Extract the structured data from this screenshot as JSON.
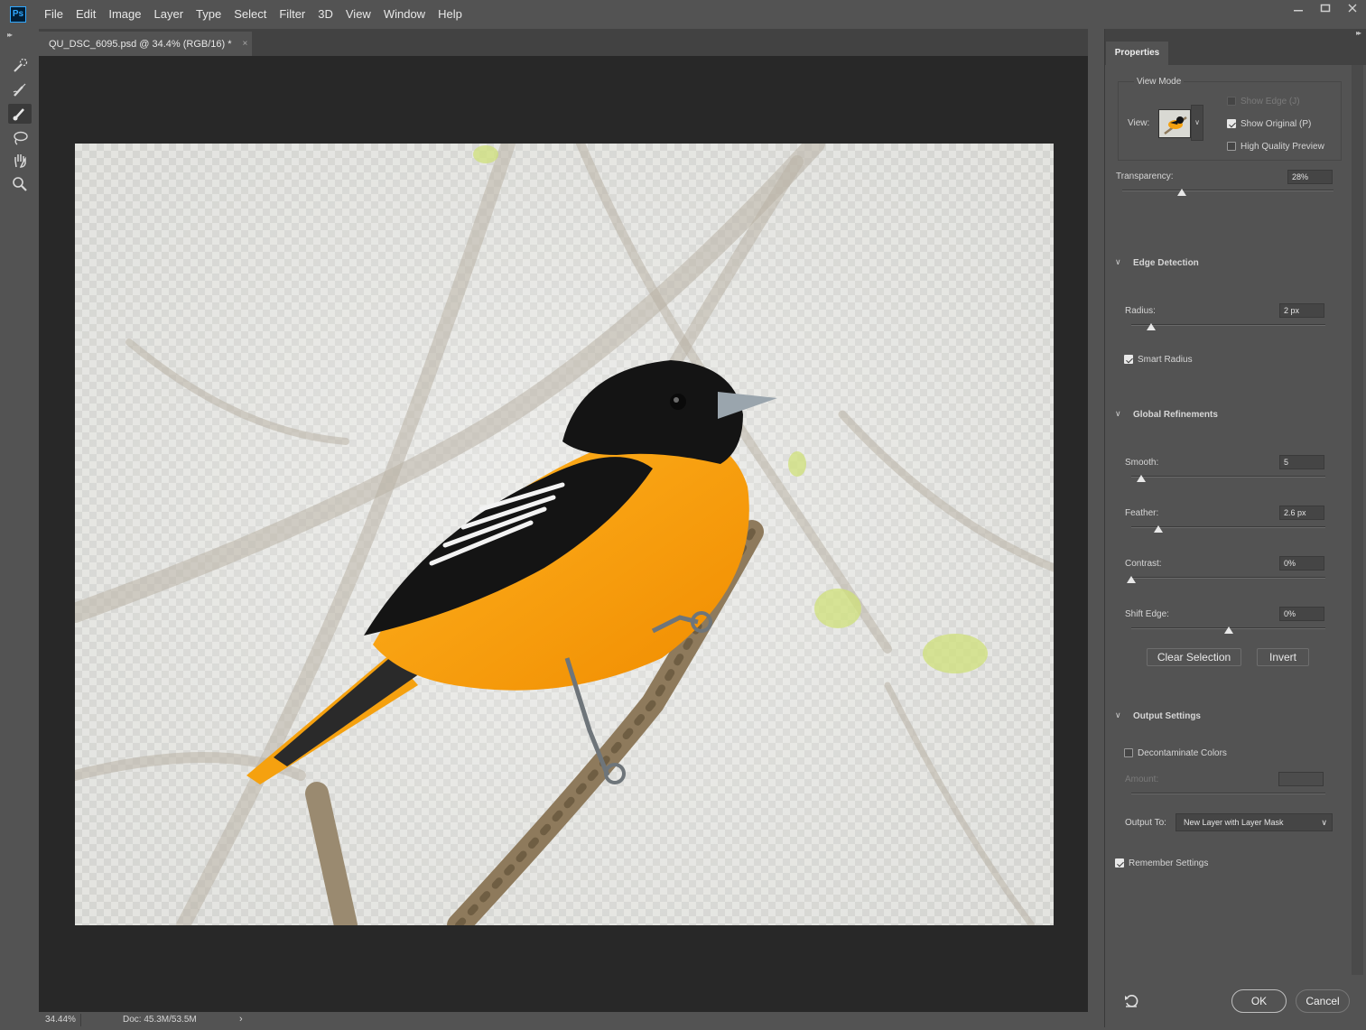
{
  "app": {
    "logo": "Ps",
    "menu": [
      "File",
      "Edit",
      "Image",
      "Layer",
      "Type",
      "Select",
      "Filter",
      "3D",
      "View",
      "Window",
      "Help"
    ],
    "window_controls": [
      "minimize-icon",
      "restore-icon",
      "close-icon"
    ]
  },
  "tools": [
    "quick-selection-icon",
    "refine-edge-brush-icon",
    "brush-icon",
    "lasso-icon",
    "hand-icon",
    "zoom-icon"
  ],
  "active_tool": "brush-icon",
  "document": {
    "tab_title": "QU_DSC_6095.psd @ 34.4% (RGB/16) *",
    "close_symbol": "×"
  },
  "statusbar": {
    "zoom": "34.44%",
    "doc_size": "Doc: 45.3M/53.5M",
    "arrow": "›"
  },
  "panel": {
    "tab": "Properties",
    "view_mode": {
      "title": "View Mode",
      "view_label": "View:",
      "show_edge": "Show Edge (J)",
      "show_original": "Show Original (P)",
      "high_quality": "High Quality Preview",
      "show_edge_checked": false,
      "show_original_checked": true,
      "high_quality_checked": false
    },
    "transparency": {
      "label": "Transparency:",
      "value": "28%",
      "level": 0.28
    },
    "edge_detection": {
      "title": "Edge Detection",
      "radius_label": "Radius:",
      "radius_value": "2 px",
      "radius_level": 0.1,
      "smart_radius": "Smart Radius",
      "smart_radius_checked": true
    },
    "global_refinements": {
      "title": "Global Refinements",
      "smooth_label": "Smooth:",
      "smooth_value": "5",
      "smooth_level": 0.05,
      "feather_label": "Feather:",
      "feather_value": "2.6 px",
      "feather_level": 0.14,
      "contrast_label": "Contrast:",
      "contrast_value": "0%",
      "contrast_level": 0.0,
      "shift_edge_label": "Shift Edge:",
      "shift_edge_value": "0%",
      "shift_edge_level": 0.5,
      "clear_selection": "Clear Selection",
      "invert": "Invert"
    },
    "output_settings": {
      "title": "Output Settings",
      "decontaminate": "Decontaminate Colors",
      "decontaminate_checked": false,
      "amount_label": "Amount:",
      "output_to_label": "Output To:",
      "output_to_value": "New Layer with Layer Mask",
      "remember": "Remember Settings",
      "remember_checked": true
    },
    "ok": "OK",
    "cancel": "Cancel"
  },
  "colors": {
    "ui_background": "#535353",
    "canvas_background": "#282828",
    "bird_orange": "#f5a10f",
    "bird_black": "#141414"
  }
}
